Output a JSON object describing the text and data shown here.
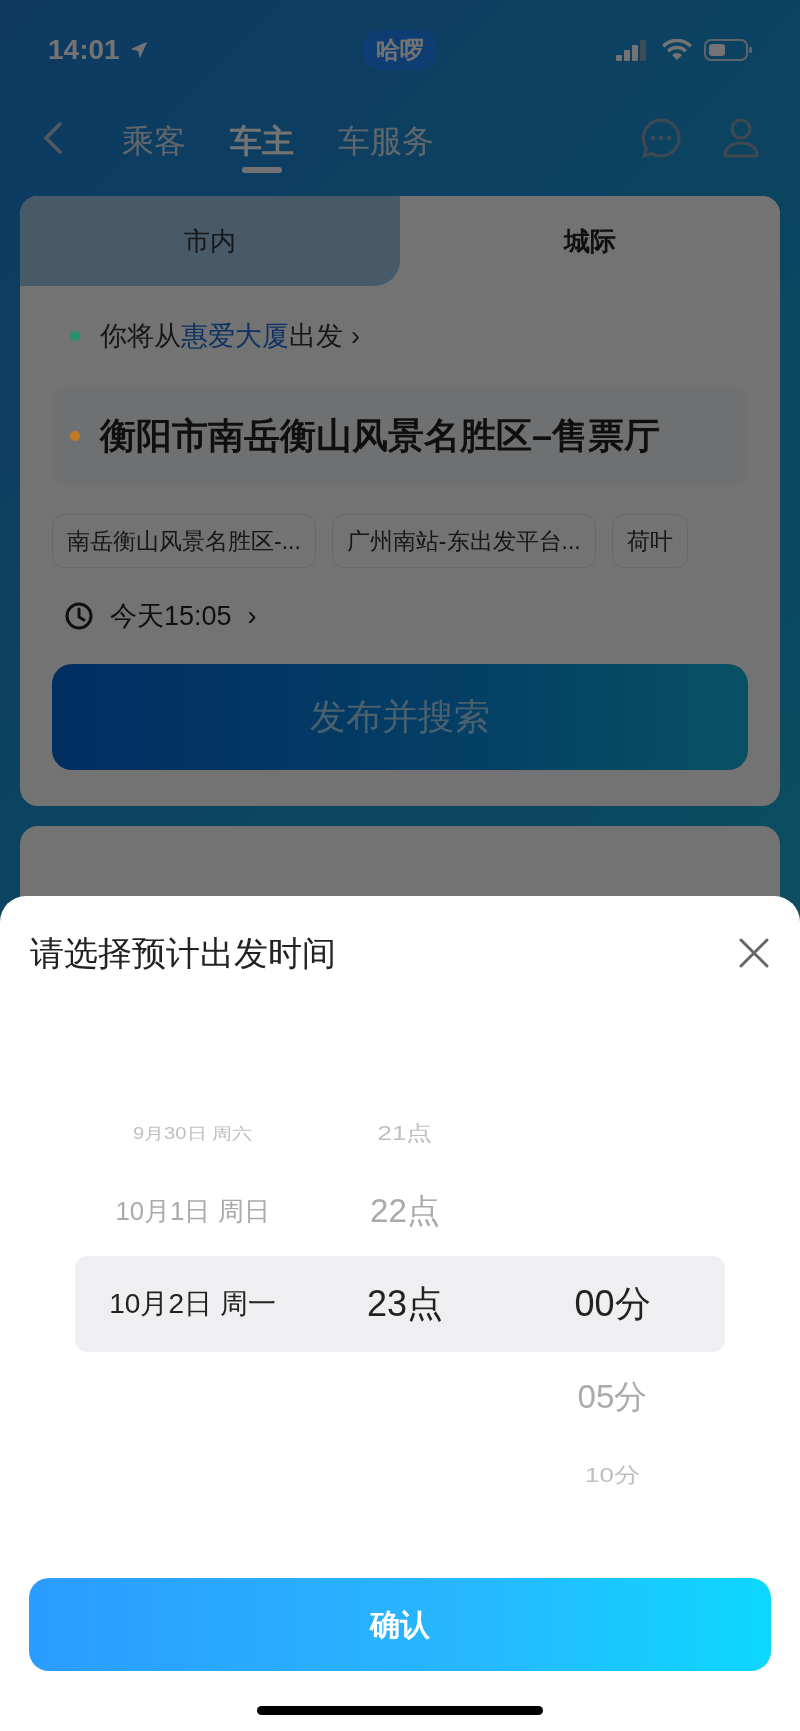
{
  "status_bar": {
    "time": "14:01",
    "pill": "哈啰"
  },
  "nav": {
    "tabs": [
      {
        "label": "乘客",
        "selected": false
      },
      {
        "label": "车主",
        "selected": true
      },
      {
        "label": "车服务",
        "selected": false
      }
    ]
  },
  "mode_tabs": [
    {
      "label": "市内",
      "selected": false
    },
    {
      "label": "城际",
      "selected": true
    }
  ],
  "origin": {
    "prefix": "你将从",
    "place": "惠爱大厦",
    "suffix": "出发",
    "chevron": "›",
    "color": "#2a8f6e"
  },
  "destination": {
    "text": "衡阳市南岳衡山风景名胜区–售票厅",
    "color": "#c27a20"
  },
  "suggestions": [
    "南岳衡山风景名胜区-...",
    "广州南站-东出发平台...",
    "荷叶"
  ],
  "departure_time": {
    "text": "今天15:05",
    "chevron": "›"
  },
  "publish_button": "发布并搜索",
  "sheet": {
    "title": "请选择预计出发时间",
    "columns": [
      {
        "items": [
          {
            "label": "9月30日 周六",
            "selected": false
          },
          {
            "label": "10月1日 周日",
            "selected": false
          },
          {
            "label": "10月2日 周一",
            "selected": true
          }
        ]
      },
      {
        "items": [
          {
            "label": "21点",
            "selected": false
          },
          {
            "label": "22点",
            "selected": false
          },
          {
            "label": "23点",
            "selected": true
          }
        ]
      },
      {
        "items": [
          {
            "label": "00分",
            "selected": true
          },
          {
            "label": "05分",
            "selected": false
          },
          {
            "label": "10分",
            "selected": false
          }
        ]
      }
    ],
    "confirm": "确认"
  }
}
